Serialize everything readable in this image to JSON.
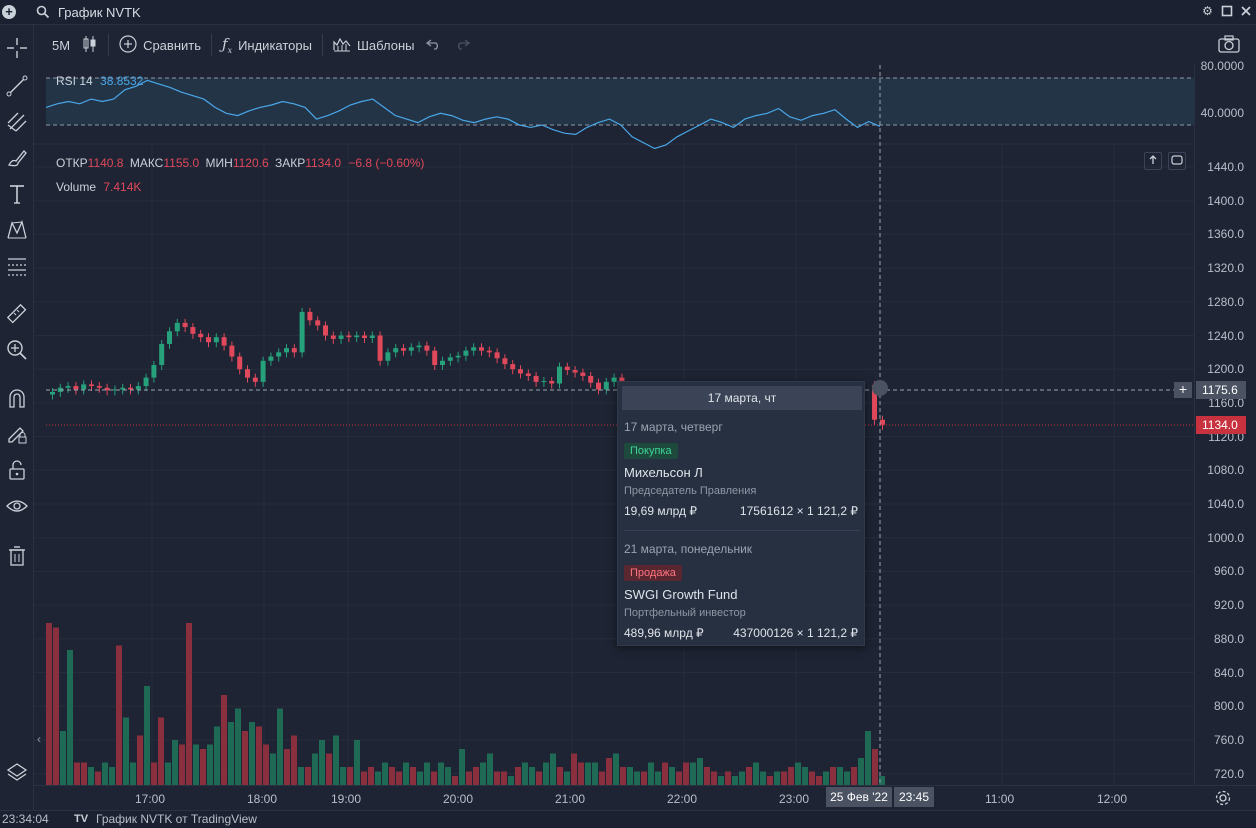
{
  "window": {
    "title": "График NVTK"
  },
  "toolbar": {
    "interval": "5M",
    "compare": "Сравнить",
    "indicators": "Индикаторы",
    "templates": "Шаблоны"
  },
  "rsi": {
    "name": "RSI 14",
    "value": "38.8532",
    "axis_labels": [
      "80.0000",
      "40.0000"
    ]
  },
  "ohlc": {
    "open_label": "ОТКР",
    "open": "1140.8",
    "high_label": "МАКС",
    "high": "1155.0",
    "low_label": "МИН",
    "low": "1120.6",
    "close_label": "ЗАКР",
    "close": "1134.0",
    "change": "−6.8 (−0.60%)"
  },
  "volume": {
    "name": "Volume",
    "value": "7.414K"
  },
  "price_axis": [
    "1440.0",
    "1400.0",
    "1360.0",
    "1320.0",
    "1280.0",
    "1240.0",
    "1200.0",
    "1160.0",
    "1120.0",
    "1080.0",
    "1040.0",
    "1000.0",
    "960.0",
    "920.0",
    "880.0",
    "840.0",
    "800.0",
    "760.0",
    "720.0"
  ],
  "crosshair_price": "1175.6",
  "last_price": "1134.0",
  "time_axis": [
    "17:00",
    "18:00",
    "19:00",
    "20:00",
    "21:00",
    "22:00",
    "23:00",
    "11:00",
    "12:00"
  ],
  "crosshair_date": "25 Фев '22",
  "crosshair_time": "23:45",
  "tooltip": {
    "header": "17 марта, чт",
    "deals": [
      {
        "date": "17 марта, четверг",
        "type": "Покупка",
        "name": "Михельсон Л",
        "role": "Председатель Правления",
        "amount": "19,69 млрд ₽",
        "qty": "17561612 × 1 121,2 ₽"
      },
      {
        "date": "21 марта, понедельник",
        "type": "Продажа",
        "name": "SWGI Growth Fund",
        "role": "Портфельный инвестор",
        "amount": "489,96 млрд ₽",
        "qty": "437000126 × 1 121,2 ₽"
      }
    ]
  },
  "status": {
    "time": "23:34:04",
    "caption": "График NVTK от TradingView"
  },
  "colors": {
    "up": "#26a17b",
    "down": "#e0485b",
    "rsi_line": "#4aa7e8",
    "background": "#1e2433"
  },
  "chart_data": {
    "type": "candlestick",
    "close_values": [
      1173,
      1178,
      1180,
      1176,
      1182,
      1180,
      1178,
      1175,
      1176,
      1178,
      1176,
      1180,
      1190,
      1205,
      1230,
      1245,
      1255,
      1250,
      1242,
      1238,
      1232,
      1238,
      1228,
      1215,
      1200,
      1190,
      1185,
      1210,
      1215,
      1220,
      1225,
      1220,
      1268,
      1258,
      1252,
      1240,
      1236,
      1240,
      1238,
      1240,
      1237,
      1240,
      1210,
      1220,
      1225,
      1222,
      1226,
      1228,
      1222,
      1205,
      1210,
      1214,
      1216,
      1222,
      1226,
      1222,
      1220,
      1213,
      1206,
      1200,
      1195,
      1192,
      1185,
      1186,
      1183,
      1203,
      1199,
      1196,
      1192,
      1184,
      1176,
      1185,
      1190,
      1180,
      1172,
      1168,
      1175,
      1180,
      1186,
      1172,
      1183,
      1181,
      1140,
      1134
    ],
    "rsi_values": [
      55,
      58,
      60,
      58,
      62,
      60,
      62,
      70,
      73,
      78,
      75,
      72,
      68,
      65,
      62,
      55,
      50,
      48,
      52,
      55,
      57,
      60,
      58,
      55,
      45,
      48,
      52,
      57,
      60,
      62,
      55,
      48,
      45,
      42,
      47,
      50,
      48,
      44,
      42,
      45,
      47,
      45,
      40,
      38,
      40,
      36,
      33,
      32,
      38,
      42,
      45,
      40,
      30,
      25,
      20,
      23,
      30,
      35,
      40,
      45,
      42,
      38,
      45,
      48,
      50,
      54,
      47,
      44,
      48,
      50,
      53,
      45,
      38,
      43,
      38.85
    ],
    "volume_values": [
      3.6,
      3.5,
      1.2,
      3.0,
      0.5,
      0.5,
      0.4,
      0.3,
      0.5,
      0.4,
      3.1,
      1.5,
      0.5,
      1.1,
      2.2,
      0.5,
      1.5,
      0.5,
      1.0,
      0.9,
      3.6,
      0.9,
      0.8,
      0.9,
      1.3,
      2.0,
      1.4,
      1.7,
      1.2,
      1.4,
      1.3,
      0.9,
      0.7,
      1.7,
      0.8,
      1.1,
      0.4,
      0.4,
      0.7,
      1.0,
      0.7,
      1.1,
      0.4,
      0.4,
      1.0,
      0.3,
      0.4,
      0.3,
      0.5,
      0.4,
      0.3,
      0.5,
      0.4,
      0.3,
      0.5,
      0.3,
      0.5,
      0.4,
      0.2,
      0.8,
      0.3,
      0.4,
      0.5,
      0.7,
      0.3,
      0.3,
      0.2,
      0.4,
      0.5,
      0.4,
      0.3,
      0.5,
      0.7,
      0.4,
      0.3,
      0.7,
      0.5,
      0.5,
      0.5,
      0.3,
      0.6,
      0.7,
      0.4,
      0.4,
      0.3,
      0.3,
      0.5,
      0.3,
      0.5,
      0.4,
      0.3,
      0.5,
      0.5,
      0.6,
      0.4,
      0.3,
      0.2,
      0.3,
      0.2,
      0.3,
      0.4,
      0.5,
      0.3,
      0.2,
      0.3,
      0.3,
      0.4,
      0.5,
      0.4,
      0.3,
      0.2,
      0.3,
      0.4,
      0.4,
      0.3,
      0.4,
      0.6,
      1.2,
      0.8,
      0.2
    ],
    "price_range": [
      700,
      1460
    ],
    "rsi_range": [
      0,
      100
    ]
  }
}
